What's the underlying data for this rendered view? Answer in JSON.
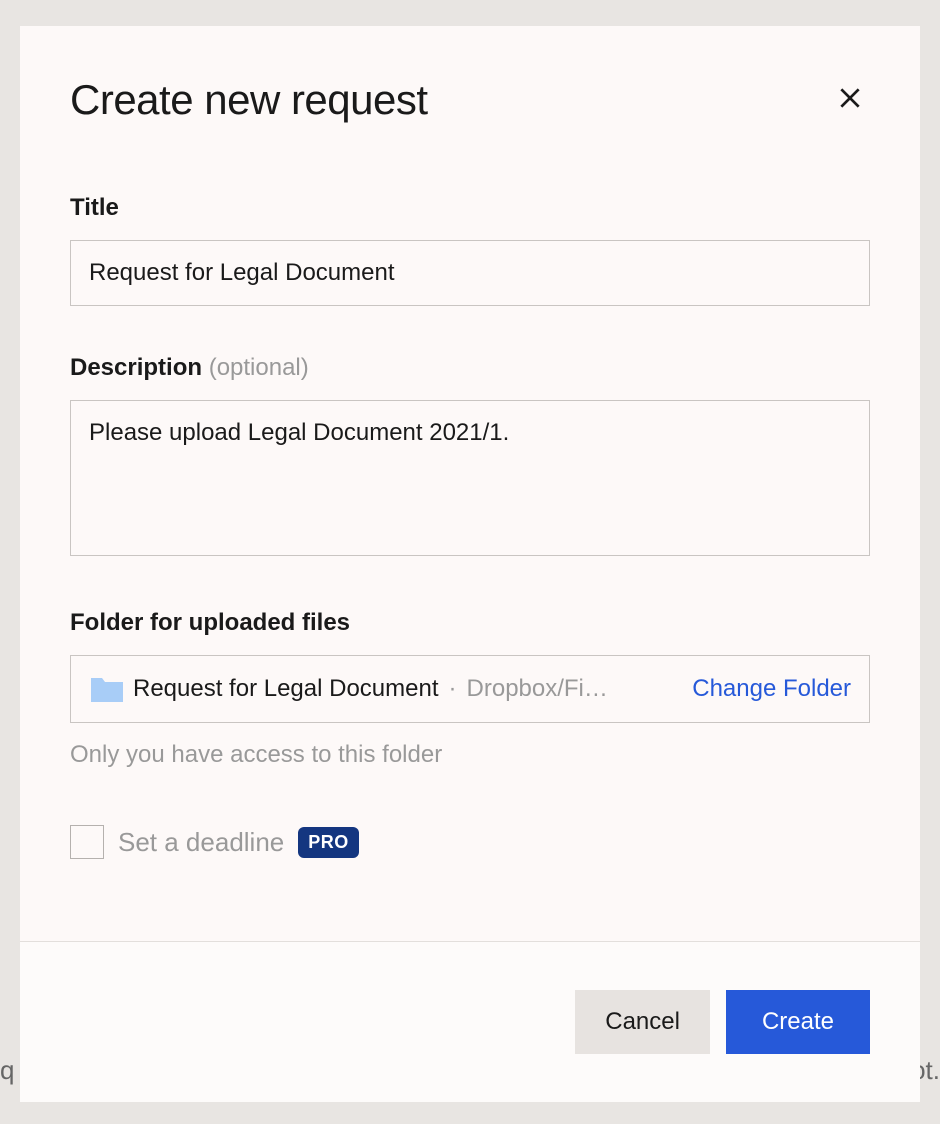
{
  "modal": {
    "title": "Create new request",
    "title_field": {
      "label": "Title",
      "value": "Request for Legal Document"
    },
    "description_field": {
      "label": "Description",
      "optional_suffix": "(optional)",
      "value": "Please upload Legal Document 2021/1."
    },
    "folder_field": {
      "label": "Folder for uploaded files",
      "folder_name": "Request for Legal Document",
      "separator": "·",
      "folder_path": "Dropbox/Fi…",
      "change_link": "Change Folder",
      "hint": "Only you have access to this folder"
    },
    "deadline": {
      "label": "Set a deadline",
      "badge": "PRO"
    },
    "footer": {
      "cancel": "Cancel",
      "create": "Create"
    }
  },
  "background": {
    "left_fragment": "q",
    "right_fragment": "ot."
  }
}
